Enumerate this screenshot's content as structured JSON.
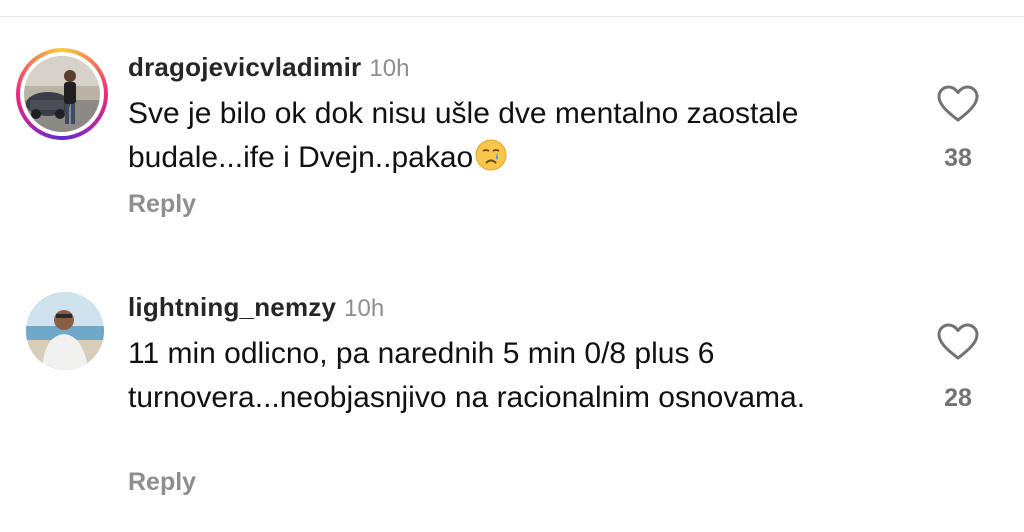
{
  "comments": [
    {
      "username": "dragojevicvladimir",
      "time": "10h",
      "text": "Sve je bilo ok dok nisu ušle dve mentalno zaostale budale...ife i Dvejn..pakao",
      "emoji": "crying-face",
      "likes": "38",
      "reply_label": "Reply",
      "has_story_ring": true
    },
    {
      "username": "lightning_nemzy",
      "time": "10h",
      "text": "11 min odlicno, pa narednih 5 min 0/8 plus 6 turnovera...neobjasnjivo na racionalnim osnovama.",
      "likes": "28",
      "reply_label": "Reply",
      "has_story_ring": false
    }
  ],
  "icons": {
    "like": "heart-outline-icon"
  },
  "colors": {
    "username": "#262626",
    "secondary": "#8e8e8e",
    "count": "#737373"
  }
}
